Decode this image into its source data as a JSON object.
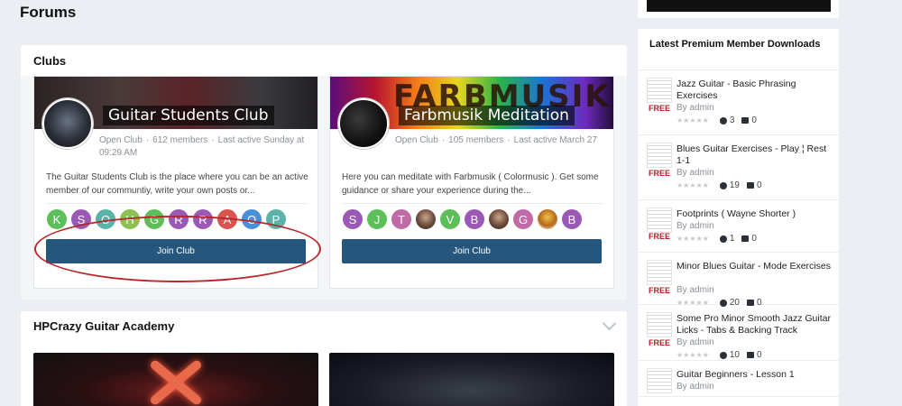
{
  "page_title": "Forums",
  "clubs_section": {
    "title": "Clubs",
    "clubs": [
      {
        "name": "Guitar Students Club",
        "type": "Open Club",
        "members": "612 members",
        "last_active": "Last active Sunday at 09:29 AM",
        "description": "The Guitar Students Club is the place where you can be an active member of our communtiy, write your own posts or...",
        "member_initials": [
          "K",
          "S",
          "O",
          "H",
          "G",
          "R",
          "R",
          "A",
          "O",
          "P"
        ],
        "member_colors": [
          "#5cbf5a",
          "#9b59b6",
          "#5ab3a8",
          "#8cc152",
          "#5cbf5a",
          "#9b59b6",
          "#9b59b6",
          "#d9534f",
          "#4a90d9",
          "#5ab3a8"
        ],
        "join_label": "Join Club"
      },
      {
        "name": "Farbmusik Meditation",
        "banner_text": "FARBMUSIK",
        "type": "Open Club",
        "members": "105 members",
        "last_active": "Last active March 27",
        "description": "Here you can meditate with Farbmusik ( Colormusic ). Get some guidance or share your experience during the...",
        "member_initials": [
          "S",
          "J",
          "T",
          "",
          "V",
          "B",
          "",
          "G",
          "",
          "B"
        ],
        "member_colors": [
          "#9b59b6",
          "#5cbf5a",
          "#c06aa8",
          "photo",
          "#5cbf5a",
          "#9b59b6",
          "photo",
          "#c06aa8",
          "photo2",
          "#9b59b6"
        ],
        "join_label": "Join Club"
      }
    ]
  },
  "academy_section": {
    "title": "HPCrazy Guitar Academy"
  },
  "sidebar": {
    "title": "Latest Premium Member Downloads",
    "items": [
      {
        "title": "Jazz Guitar - Basic Phrasing Exercises",
        "by": "By admin",
        "price": "FREE",
        "downloads": "3",
        "comments": "0"
      },
      {
        "title": "Blues Guitar Exercises - Play ¦ Rest 1-1",
        "by": "By admin",
        "price": "FREE",
        "downloads": "19",
        "comments": "0"
      },
      {
        "title": "Footprints ( Wayne Shorter )",
        "by": "By admin",
        "price": "FREE",
        "downloads": "1",
        "comments": "0"
      },
      {
        "title": "Minor Blues Guitar - Mode Exercises",
        "by": "By admin",
        "price": "FREE",
        "downloads": "20",
        "comments": "0"
      },
      {
        "title": "Some Pro Minor Smooth Jazz Guitar Licks - Tabs & Backing Track",
        "by": "By admin",
        "price": "FREE",
        "downloads": "10",
        "comments": "0"
      },
      {
        "title": "Guitar Beginners - Lesson 1",
        "by": "By admin",
        "price": "",
        "downloads": "",
        "comments": ""
      }
    ]
  },
  "colors": {
    "accent": "#24567e",
    "free_badge": "#b3242a",
    "annotation": "#b9262a",
    "background": "#ebeef2"
  }
}
